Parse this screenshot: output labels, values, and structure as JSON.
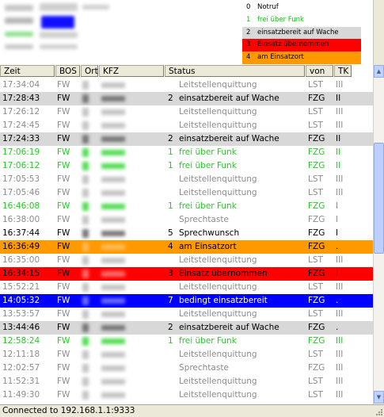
{
  "legend": [
    {
      "num": "0",
      "label": "Notruf",
      "bg": "#ffffff",
      "fg": "#000000"
    },
    {
      "num": "1",
      "label": "frei über Funk",
      "bg": "#ffffff",
      "fg": "#00cc00"
    },
    {
      "num": "2",
      "label": "einsatzbereit auf Wache",
      "bg": "#d8d8d8",
      "fg": "#000000"
    },
    {
      "num": "3",
      "label": "Einsatz übernommen",
      "bg": "#ff0000",
      "fg": "#000000"
    },
    {
      "num": "4",
      "label": "am Einsatzort",
      "bg": "#ff9900",
      "fg": "#000000"
    }
  ],
  "columns": {
    "zeit": "Zeit",
    "bos": "BOS",
    "ort": "Ort",
    "kfz": "KFZ",
    "status": "Status",
    "von": "von",
    "tk": "TK"
  },
  "rows": [
    {
      "time": "17:34:04",
      "bos": "FW",
      "num": "",
      "status": "Leitstellenquittung",
      "von": "LST",
      "tk": "III",
      "style": "gray"
    },
    {
      "time": "17:28:43",
      "bos": "FW",
      "num": "2",
      "status": "einsatzbereit auf Wache",
      "von": "FZG",
      "tk": "II",
      "style": "lightgray"
    },
    {
      "time": "17:26:12",
      "bos": "FW",
      "num": "",
      "status": "Leitstellenquittung",
      "von": "LST",
      "tk": "III",
      "style": "gray"
    },
    {
      "time": "17:24:45",
      "bos": "FW",
      "num": "",
      "status": "Leitstellenquittung",
      "von": "LST",
      "tk": "III",
      "style": "gray"
    },
    {
      "time": "17:24:33",
      "bos": "FW",
      "num": "2",
      "status": "einsatzbereit auf Wache",
      "von": "FZG",
      "tk": "II",
      "style": "lightgray"
    },
    {
      "time": "17:06:19",
      "bos": "FW",
      "num": "1",
      "status": "frei über Funk",
      "von": "FZG",
      "tk": "II",
      "style": "green"
    },
    {
      "time": "17:06:12",
      "bos": "FW",
      "num": "1",
      "status": "frei über Funk",
      "von": "FZG",
      "tk": "II",
      "style": "green"
    },
    {
      "time": "17:05:53",
      "bos": "FW",
      "num": "",
      "status": "Leitstellenquittung",
      "von": "LST",
      "tk": "III",
      "style": "gray"
    },
    {
      "time": "17:05:46",
      "bos": "FW",
      "num": "",
      "status": "Leitstellenquittung",
      "von": "LST",
      "tk": "III",
      "style": "gray"
    },
    {
      "time": "16:46:08",
      "bos": "FW",
      "num": "1",
      "status": "frei über Funk",
      "von": "FZG",
      "tk": "I",
      "style": "green"
    },
    {
      "time": "16:38:00",
      "bos": "FW",
      "num": "",
      "status": "Sprechtaste",
      "von": "FZG",
      "tk": "I",
      "style": "gray"
    },
    {
      "time": "16:37:44",
      "bos": "FW",
      "num": "5",
      "status": "Sprechwunsch",
      "von": "FZG",
      "tk": "I",
      "style": "black"
    },
    {
      "time": "16:36:49",
      "bos": "FW",
      "num": "4",
      "status": "am Einsatzort",
      "von": "FZG",
      "tk": ".",
      "style": "orange"
    },
    {
      "time": "16:35:00",
      "bos": "FW",
      "num": "",
      "status": "Leitstellenquittung",
      "von": "LST",
      "tk": "III",
      "style": "gray"
    },
    {
      "time": "16:34:15",
      "bos": "FW",
      "num": "3",
      "status": "Einsatz übernommen",
      "von": "FZG",
      "tk": "I",
      "style": "red"
    },
    {
      "time": "15:52:21",
      "bos": "FW",
      "num": "",
      "status": "Leitstellenquittung",
      "von": "LST",
      "tk": "III",
      "style": "gray"
    },
    {
      "time": "14:05:32",
      "bos": "FW",
      "num": "7",
      "status": "bedingt einsatzbereit",
      "von": "FZG",
      "tk": ".",
      "style": "blue"
    },
    {
      "time": "13:53:57",
      "bos": "FW",
      "num": "",
      "status": "Leitstellenquittung",
      "von": "LST",
      "tk": "III",
      "style": "gray"
    },
    {
      "time": "13:44:46",
      "bos": "FW",
      "num": "2",
      "status": "einsatzbereit auf Wache",
      "von": "FZG",
      "tk": ".",
      "style": "lightgray"
    },
    {
      "time": "12:58:24",
      "bos": "FW",
      "num": "1",
      "status": "frei über Funk",
      "von": "FZG",
      "tk": "III",
      "style": "green"
    },
    {
      "time": "12:11:18",
      "bos": "FW",
      "num": "",
      "status": "Leitstellenquittung",
      "von": "LST",
      "tk": "III",
      "style": "gray"
    },
    {
      "time": "12:02:57",
      "bos": "FW",
      "num": "",
      "status": "Sprechtaste",
      "von": "FZG",
      "tk": "III",
      "style": "gray"
    },
    {
      "time": "11:52:31",
      "bos": "FW",
      "num": "",
      "status": "Leitstellenquittung",
      "von": "LST",
      "tk": "III",
      "style": "gray"
    },
    {
      "time": "11:49:30",
      "bos": "FW",
      "num": "",
      "status": "Leitstellenquittung",
      "von": "LST",
      "tk": "III",
      "style": "gray"
    }
  ],
  "styles": {
    "gray": {
      "bg": "#ffffff",
      "fg": "#8c8c8c"
    },
    "lightgray": {
      "bg": "#d8d8d8",
      "fg": "#000000"
    },
    "green": {
      "bg": "#ffffff",
      "fg": "#22cc22"
    },
    "black": {
      "bg": "#ffffff",
      "fg": "#000000"
    },
    "orange": {
      "bg": "#ff9900",
      "fg": "#000000"
    },
    "red": {
      "bg": "#ff0000",
      "fg": "#000000"
    },
    "blue": {
      "bg": "#0000ff",
      "fg": "#ffffff"
    }
  },
  "statusbar": {
    "text": "Connected to 192.168.1.1:9333"
  },
  "icons": {
    "scroll_up": "arrow-up-icon",
    "scroll_down": "arrow-down-icon",
    "resize_grip": "resize-grip-icon"
  }
}
